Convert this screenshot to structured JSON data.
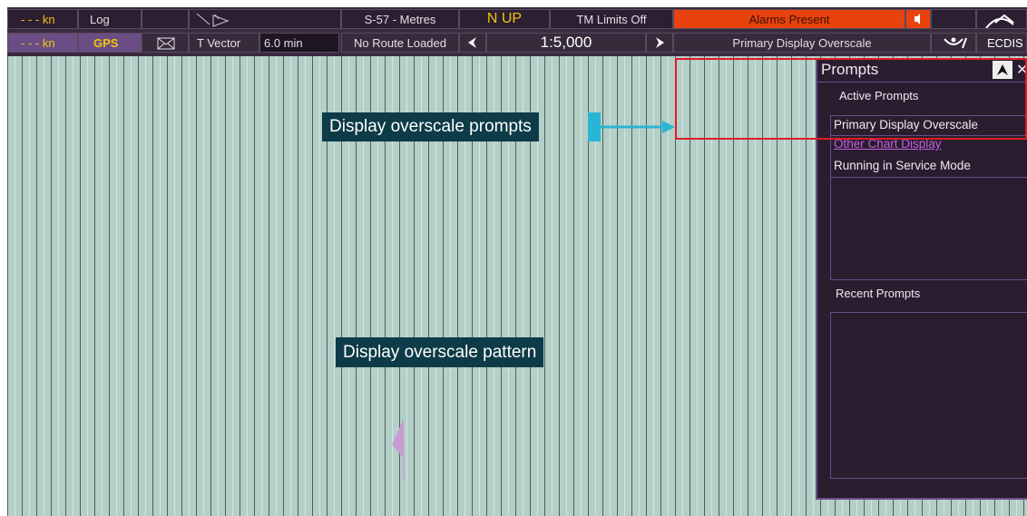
{
  "toolbar": {
    "log_speed": "- - - kn",
    "log_label": "Log",
    "gps_speed": "- - - kn",
    "gps_label": "GPS",
    "vector_label": "T Vector",
    "vector_value": "6.0 min",
    "units": "S-57 - Metres",
    "route": "No Route Loaded",
    "orientation": "N UP",
    "tm_limits": "TM Limits Off",
    "scale": "1:5,000",
    "alarms": "Alarms Present",
    "overscale_prompt": "Primary Display Overscale",
    "mode": "ECDIS"
  },
  "prompts_panel": {
    "title": "Prompts",
    "active_heading": "Active Prompts",
    "active_items": [
      "Primary Display Overscale",
      "Other Chart Display",
      "Running in Service Mode"
    ],
    "recent_heading": "Recent Prompts"
  },
  "annotations": {
    "prompts_callout": "Display overscale prompts",
    "pattern_callout": "Display overscale pattern"
  },
  "colors": {
    "chart_background": "#b3cfc8",
    "alarm": "#e8420f",
    "accent_purple": "#6a4d85",
    "highlight_red": "#e01b24"
  }
}
